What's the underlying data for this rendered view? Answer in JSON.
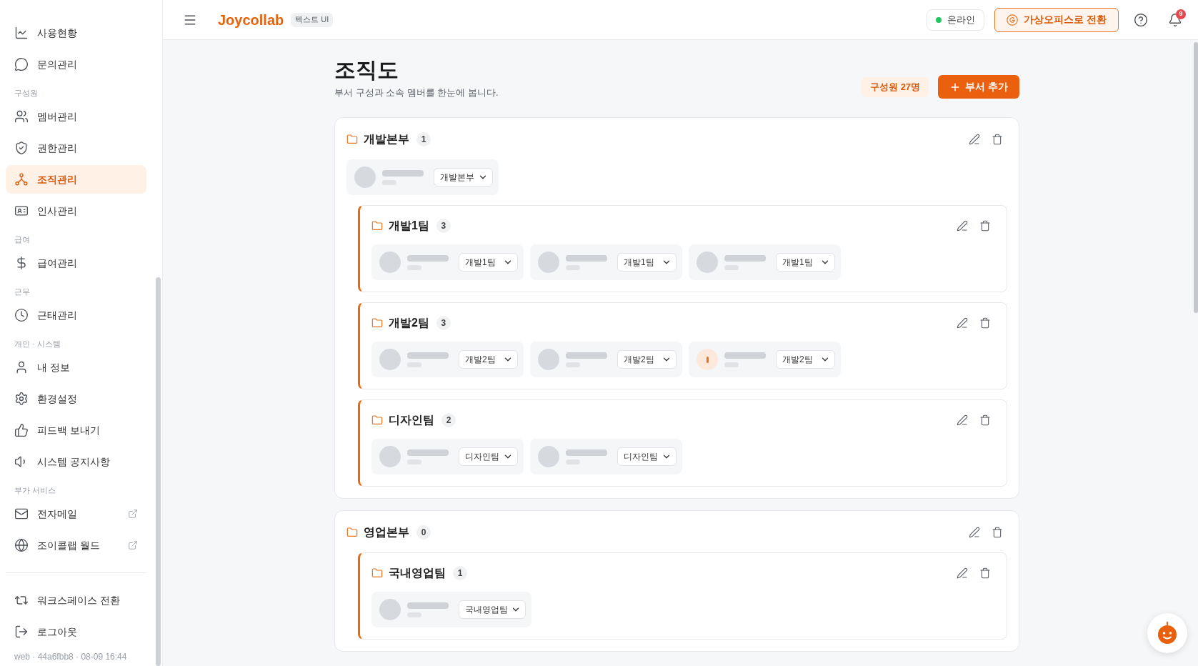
{
  "sidebar": {
    "sections": [
      {
        "items": [
          {
            "label": "사용현황",
            "selected": false,
            "external": false
          },
          {
            "label": "문의관리",
            "selected": false,
            "external": false
          }
        ]
      },
      {
        "label": "구성원",
        "items": [
          {
            "label": "멤버관리",
            "selected": false,
            "external": false
          },
          {
            "label": "권한관리",
            "selected": false,
            "external": false
          },
          {
            "label": "조직관리",
            "selected": true,
            "external": false
          },
          {
            "label": "인사관리",
            "selected": false,
            "external": false
          }
        ]
      },
      {
        "label": "급여",
        "items": [
          {
            "label": "급여관리",
            "selected": false,
            "external": false
          }
        ]
      },
      {
        "label": "근무",
        "items": [
          {
            "label": "근태관리",
            "selected": false,
            "external": false
          }
        ]
      },
      {
        "label": "개인 · 시스템",
        "items": [
          {
            "label": "내 정보",
            "selected": false,
            "external": false
          },
          {
            "label": "환경설정",
            "selected": false,
            "external": false
          },
          {
            "label": "피드백 보내기",
            "selected": false,
            "external": false
          },
          {
            "label": "시스템 공지사항",
            "selected": false,
            "external": false
          }
        ]
      },
      {
        "label": "부가 서비스",
        "items": [
          {
            "label": "전자메일",
            "selected": false,
            "external": true
          },
          {
            "label": "조이콜랩 월드",
            "selected": false,
            "external": true
          }
        ]
      }
    ],
    "footer_items": [
      {
        "label": "워크스페이스 전환"
      },
      {
        "label": "로그아웃"
      }
    ],
    "version": "web · 44a6fbb8 · 08-09 16:44"
  },
  "top_bar": {
    "brand": "Joycollab",
    "brand_badge": "텍스트 UI",
    "status": {
      "label": "온라인",
      "online": true
    },
    "switch_button": "가상오피스로 전환",
    "notification_count": "9"
  },
  "page": {
    "title": "조직도",
    "subtitle": "부서 구성과 소속 멤버를 한눈에 봅니다.",
    "member_total": "구성원 27명",
    "add_button": "부서 추가"
  },
  "departments": [
    {
      "name": "개발본부",
      "member_count": "1",
      "members": [
        {
          "kind": "photo",
          "team": "개발본부"
        }
      ],
      "children": [
        {
          "name": "개발1팀",
          "member_count": "3",
          "members": [
            {
              "kind": "photo",
              "team": "개발1팀"
            },
            {
              "kind": "photo",
              "team": "개발1팀"
            },
            {
              "kind": "photo",
              "team": "개발1팀"
            }
          ]
        },
        {
          "name": "개발2팀",
          "member_count": "3",
          "members": [
            {
              "kind": "photo",
              "team": "개발2팀"
            },
            {
              "kind": "photo",
              "team": "개발2팀"
            },
            {
              "kind": "initial",
              "team": "개발2팀"
            }
          ]
        },
        {
          "name": "디자인팀",
          "member_count": "2",
          "members": [
            {
              "kind": "photo",
              "team": "디자인팀"
            },
            {
              "kind": "photo",
              "team": "디자인팀"
            }
          ]
        }
      ]
    },
    {
      "name": "영업본부",
      "member_count": "0",
      "children": [
        {
          "name": "국내영업팀",
          "member_count": "1",
          "members": [
            {
              "kind": "photo",
              "team": "국내영업팀"
            }
          ]
        }
      ]
    }
  ]
}
